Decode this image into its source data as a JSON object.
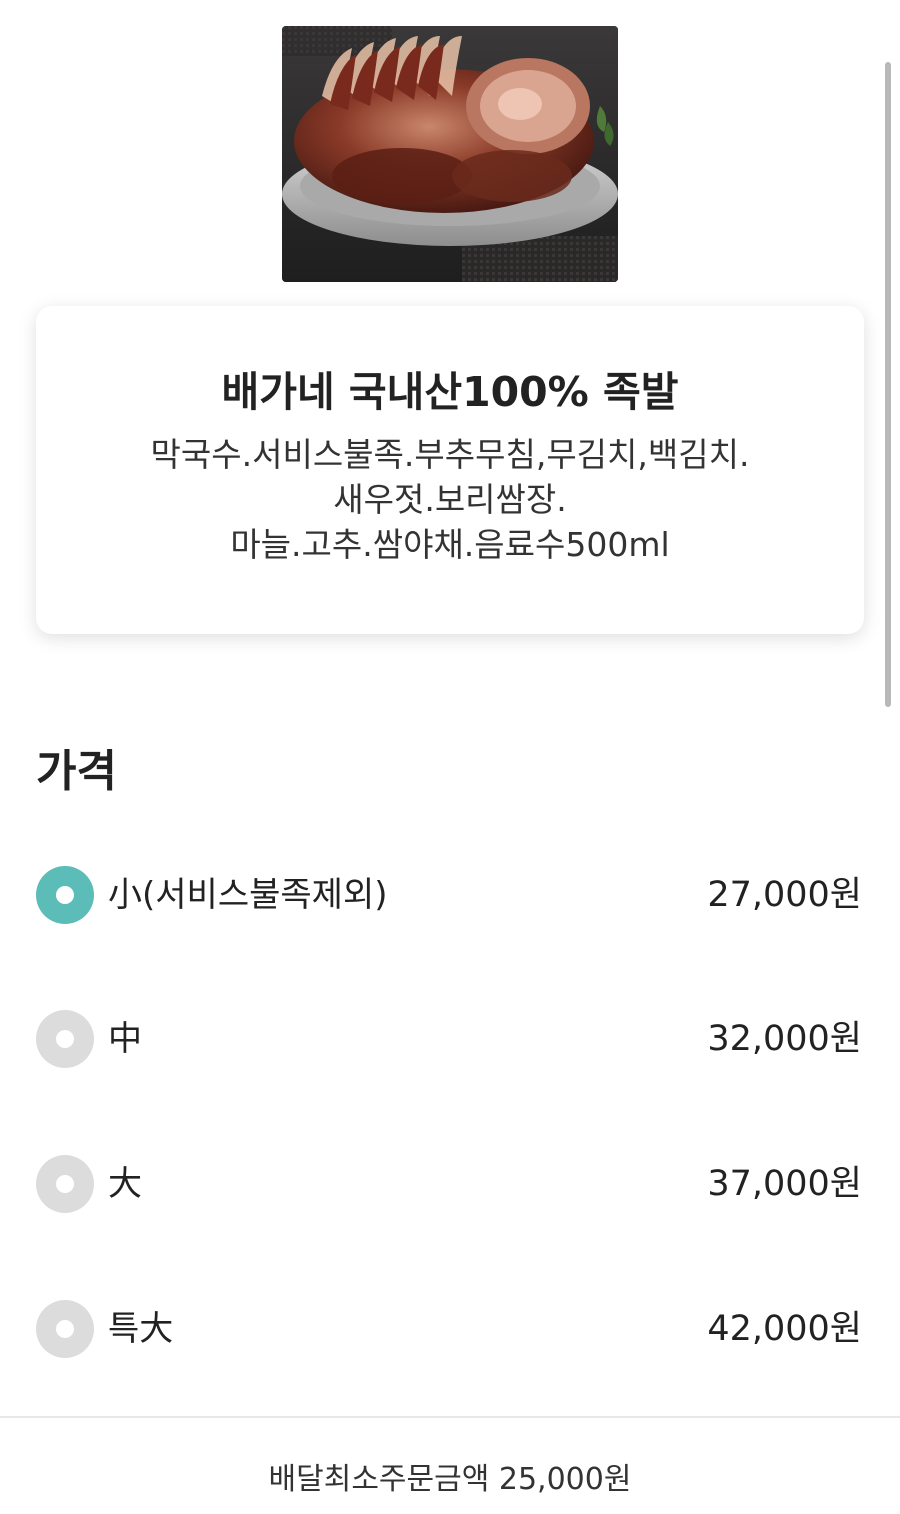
{
  "menu": {
    "title": "배가네 국내산100% 족발",
    "description": [
      "막국수.서비스불족.부추무침,무김치,백김치.",
      "새우젓.보리쌈장.",
      "마늘.고추.쌈야채.음료수500ml"
    ]
  },
  "price_section": {
    "title": "가격",
    "options": [
      {
        "label": "小(서비스불족제외)",
        "price": "27,000원",
        "selected": true
      },
      {
        "label": "中",
        "price": "32,000원",
        "selected": false
      },
      {
        "label": "大",
        "price": "37,000원",
        "selected": false
      },
      {
        "label": "특大",
        "price": "42,000원",
        "selected": false
      }
    ]
  },
  "footer": {
    "min_order": "배달최소주문금액 25,000원"
  },
  "colors": {
    "accent": "#5bbcb8",
    "radio_unselected": "#dcdcdc",
    "text": "#222222"
  },
  "icons": {
    "radio": "radio-button-icon"
  }
}
